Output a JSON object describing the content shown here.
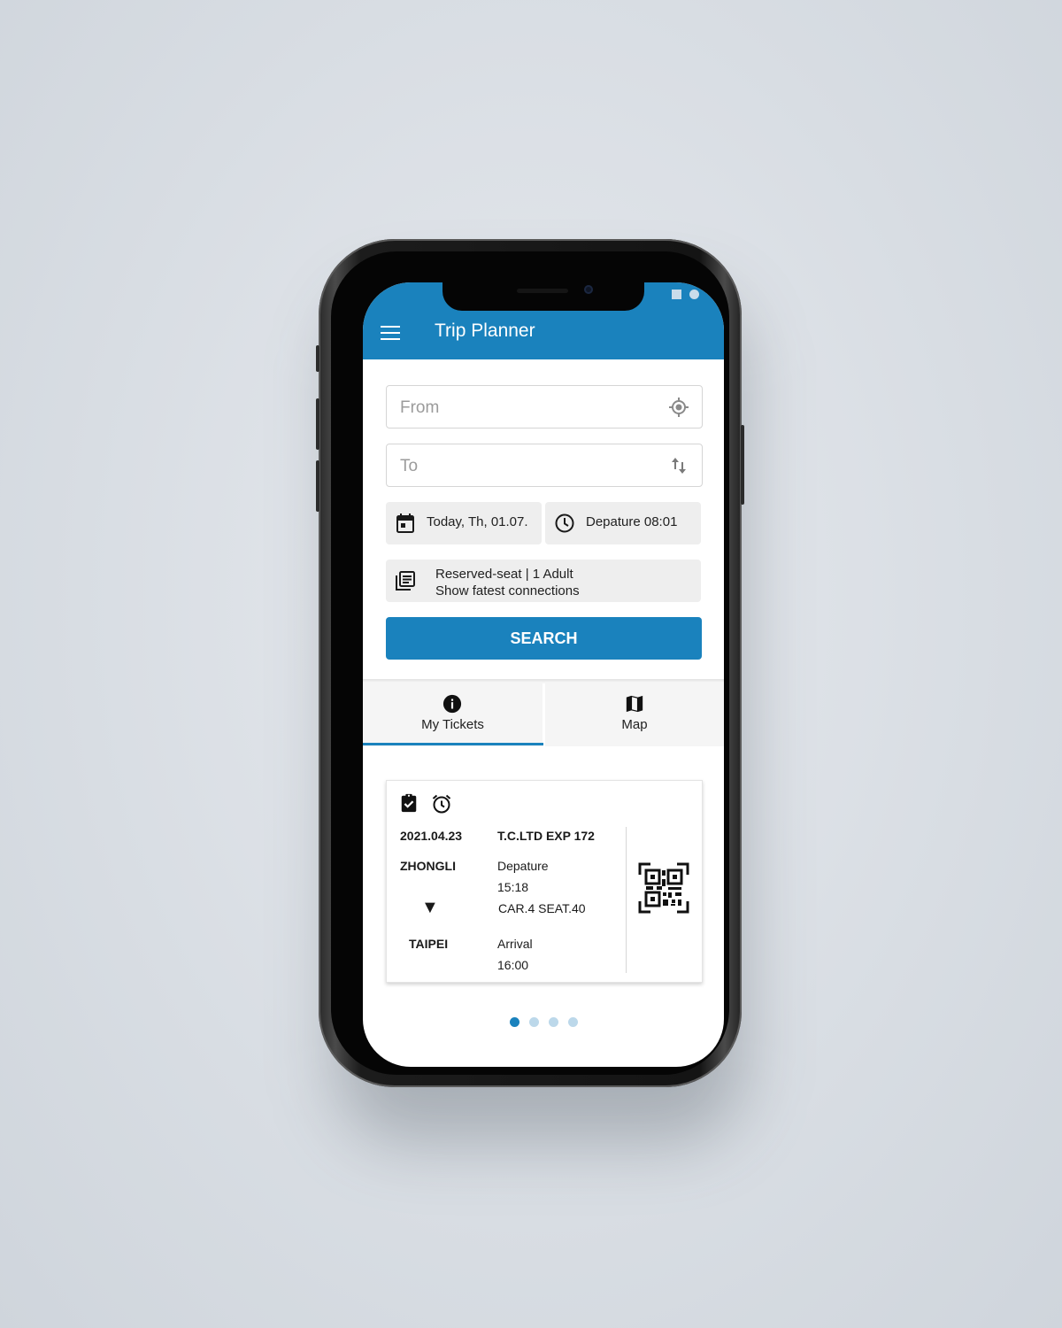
{
  "app": {
    "title": "Trip Planner",
    "accent_color": "#1a82bd"
  },
  "form": {
    "from_placeholder": "From",
    "to_placeholder": "To",
    "date_label": "Today, Th, 01.07.",
    "time_label": "Depature 08:01",
    "options_line1": "Reserved-seat | 1 Adult",
    "options_line2": "Show fatest connections",
    "search_label": "SEARCH"
  },
  "tabs": [
    {
      "label": "My Tickets",
      "icon": "info-icon",
      "active": true
    },
    {
      "label": "Map",
      "icon": "map-icon",
      "active": false
    }
  ],
  "ticket": {
    "date": "2021.04.23",
    "train": "T.C.LTD EXP 172",
    "from_station": "ZHONGLI",
    "to_station": "TAIPEI",
    "departure_label": "Depature",
    "departure_time": "15:18",
    "seat": "CAR.4 SEAT.40",
    "arrival_label": "Arrival",
    "arrival_time": "16:00",
    "direction_glyph": "▼",
    "icons": [
      "clipboard-check-icon",
      "alarm-icon",
      "qr-code-icon"
    ]
  },
  "pager": {
    "count": 4,
    "active_index": 0
  }
}
